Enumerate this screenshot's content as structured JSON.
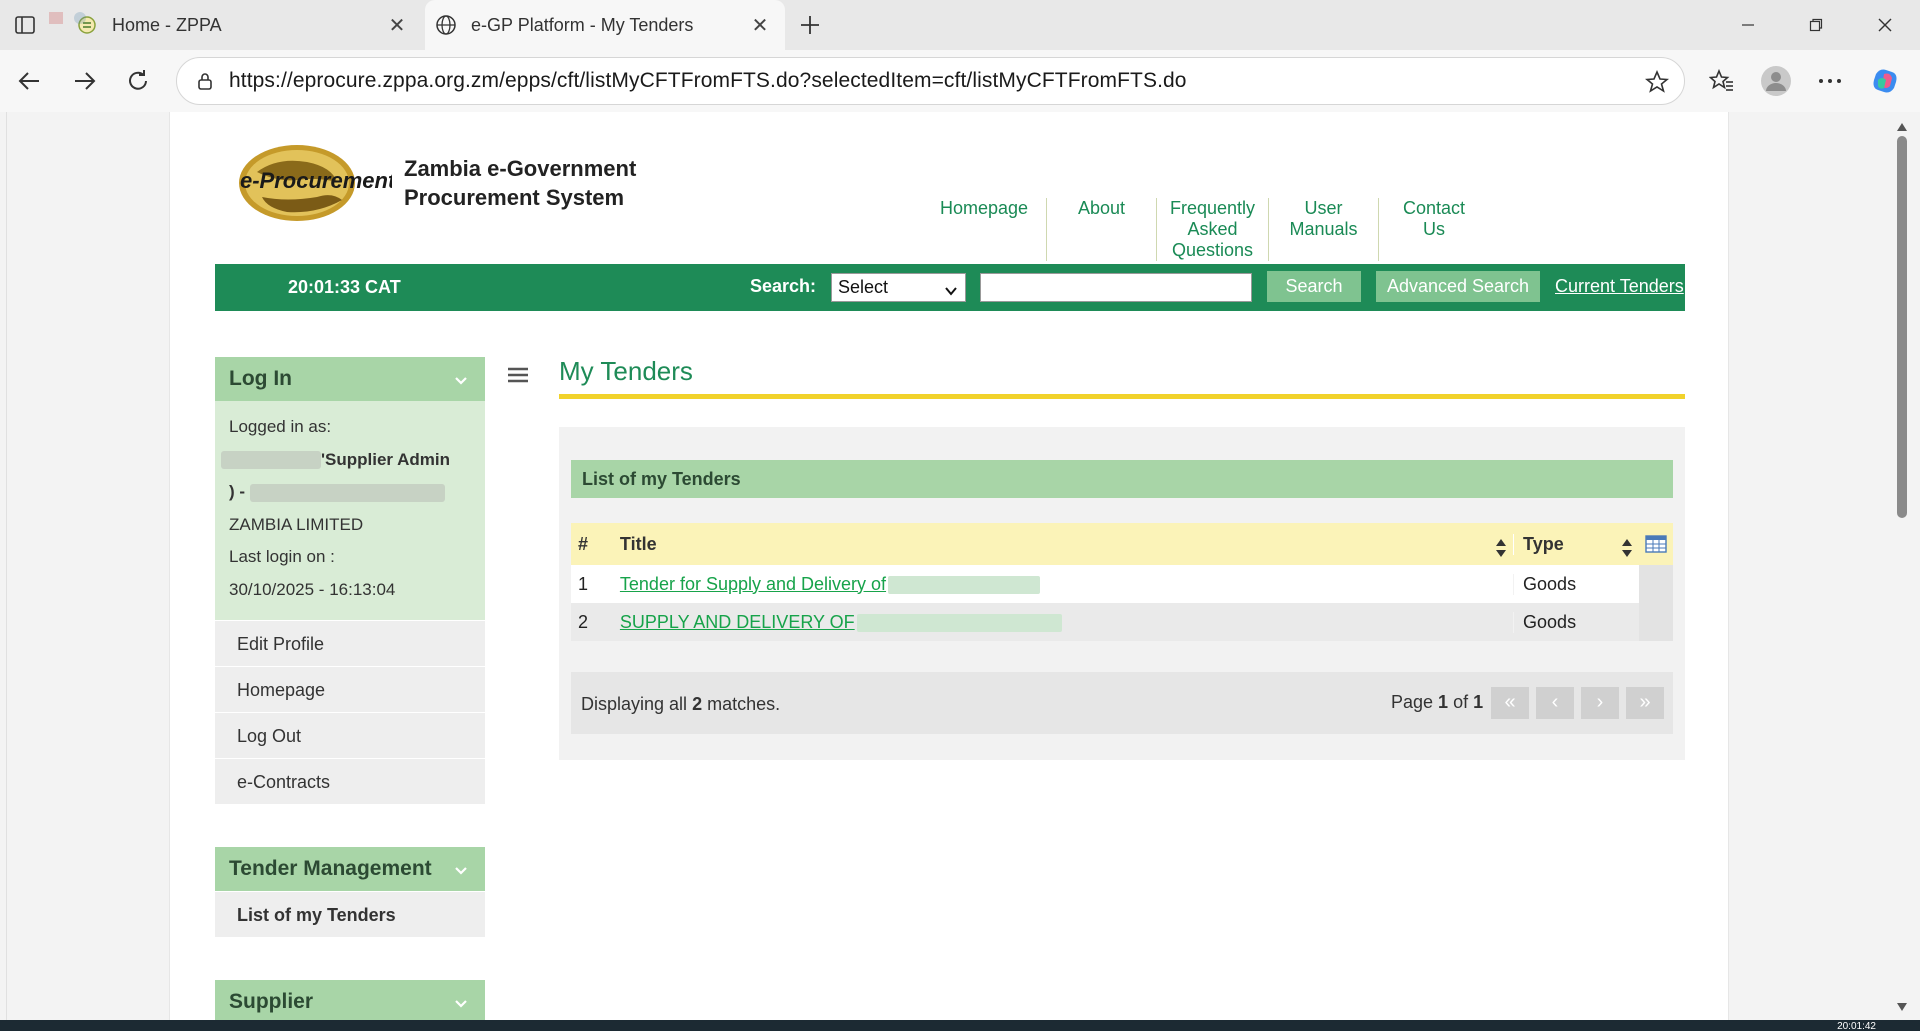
{
  "browser": {
    "tabs": [
      {
        "title": "Home - ZPPA"
      },
      {
        "title": "e-GP Platform - My Tenders"
      }
    ],
    "url": "https://eprocure.zppa.org.zm/epps/cft/listMyCFTFromFTS.do?selectedItem=cft/listMyCFTFromFTS.do",
    "taskbar_clock": "20:01:42"
  },
  "site": {
    "logo_text": "e-Procurement",
    "title_line1": "Zambia e-Government",
    "title_line2": "Procurement System",
    "nav": [
      {
        "label": "Homepage"
      },
      {
        "label": "About"
      },
      {
        "label": "Frequently Asked Questions"
      },
      {
        "label": "User Manuals"
      },
      {
        "label": "Contact Us"
      }
    ]
  },
  "bar": {
    "time": "20:01:33 CAT",
    "search_label": "Search:",
    "select_value": "Select",
    "search_button": "Search",
    "advanced_button": "Advanced Search",
    "current_tenders": "Current Tenders"
  },
  "sidebar": {
    "login_header": "Log In",
    "logged_in_as": "Logged in as:",
    "role": "'Supplier Admin",
    "paren": ") -",
    "company": "ZAMBIA LIMITED",
    "last_login_label": "Last login on :",
    "last_login_value": "30/10/2025 - 16:13:04",
    "menu": [
      {
        "label": "Edit Profile"
      },
      {
        "label": "Homepage"
      },
      {
        "label": "Log Out"
      },
      {
        "label": "e-Contracts"
      }
    ],
    "tender_header": "Tender Management",
    "tender_items": [
      {
        "label": "List of my Tenders"
      }
    ],
    "supplier_header": "Supplier"
  },
  "main": {
    "title": "My Tenders",
    "panel_title": "List of my Tenders",
    "columns": {
      "num": "#",
      "title": "Title",
      "type": "Type"
    },
    "rows": [
      {
        "num": "1",
        "title": "Tender for Supply and Delivery of",
        "type": "Goods"
      },
      {
        "num": "2",
        "title": "SUPPLY AND DELIVERY OF",
        "type": "Goods"
      }
    ],
    "pager": {
      "displaying_prefix": "Displaying all ",
      "count": "2",
      "displaying_suffix": " matches.",
      "page_prefix": "Page ",
      "page_current": "1",
      "page_of": " of ",
      "page_total": "1",
      "first": "«",
      "prev": "‹",
      "next": "›",
      "last": "»"
    }
  },
  "colors": {
    "green_bar": "#1e8b57",
    "light_green": "#a8d5a7",
    "accent_yellow": "#f1d22b",
    "link_green": "#17a34a"
  }
}
